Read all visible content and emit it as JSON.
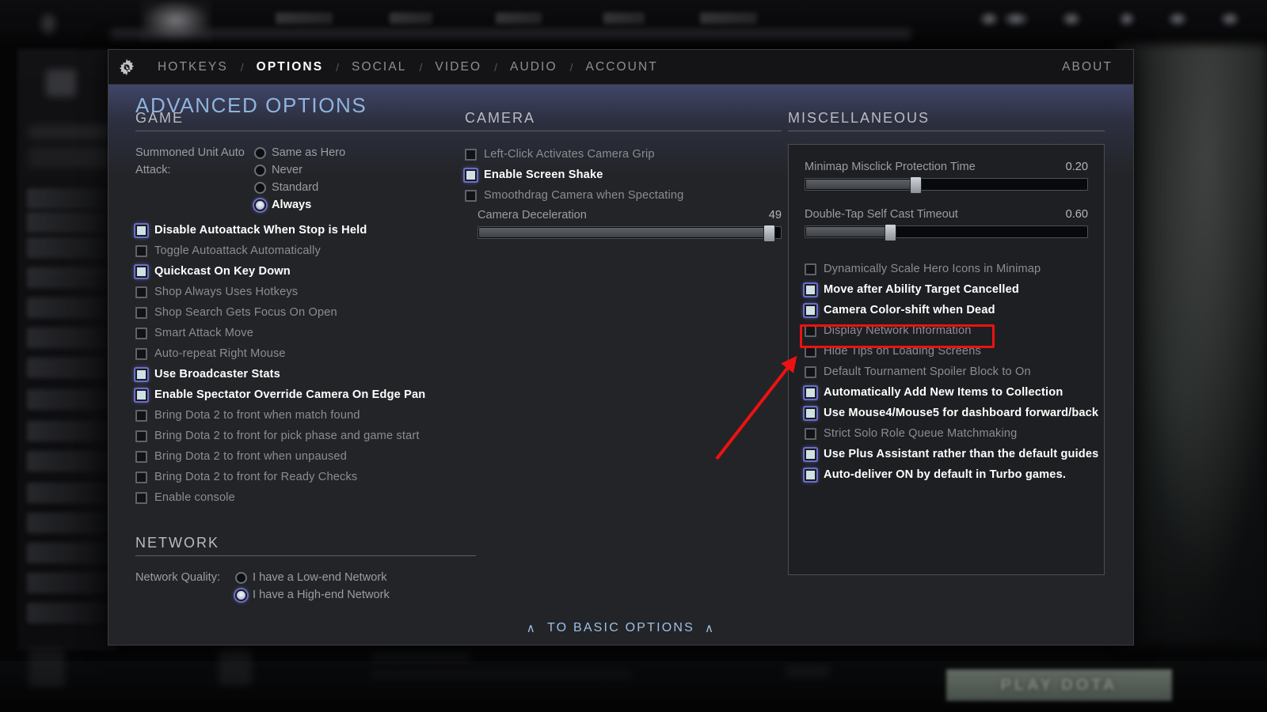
{
  "background": {
    "nav_items": [
      "HEROES",
      "STORE",
      "WATCH",
      "LEARN",
      "ARCADE"
    ],
    "play_button_label": "PLAY DOTA"
  },
  "header": {
    "gear_icon": "gear-cursor-icon",
    "tabs": [
      {
        "label": "HOTKEYS",
        "active": false
      },
      {
        "label": "OPTIONS",
        "active": true
      },
      {
        "label": "SOCIAL",
        "active": false
      },
      {
        "label": "VIDEO",
        "active": false
      },
      {
        "label": "AUDIO",
        "active": false
      },
      {
        "label": "ACCOUNT",
        "active": false
      }
    ],
    "separator": "/",
    "about_label": "ABOUT"
  },
  "page_title": "ADVANCED OPTIONS",
  "game": {
    "heading": "GAME",
    "summoned_unit": {
      "label": "Summoned Unit Auto Attack:",
      "options": [
        {
          "label": "Same as Hero",
          "selected": false
        },
        {
          "label": "Never",
          "selected": false
        },
        {
          "label": "Standard",
          "selected": false
        },
        {
          "label": "Always",
          "selected": true
        }
      ]
    },
    "checkboxes": [
      {
        "label": "Disable Autoattack When Stop is Held",
        "checked": true
      },
      {
        "label": "Toggle Autoattack Automatically",
        "checked": false
      },
      {
        "label": "Quickcast On Key Down",
        "checked": true
      },
      {
        "label": "Shop Always Uses Hotkeys",
        "checked": false
      },
      {
        "label": "Shop Search Gets Focus On Open",
        "checked": false
      },
      {
        "label": "Smart Attack Move",
        "checked": false
      },
      {
        "label": "Auto-repeat Right Mouse",
        "checked": false
      },
      {
        "label": "Use Broadcaster Stats",
        "checked": true
      },
      {
        "label": "Enable Spectator Override Camera On Edge Pan",
        "checked": true
      },
      {
        "label": "Bring Dota 2 to front when match found",
        "checked": false
      },
      {
        "label": "Bring Dota 2 to front for pick phase and game start",
        "checked": false
      },
      {
        "label": "Bring Dota 2 to front when unpaused",
        "checked": false
      },
      {
        "label": "Bring Dota 2 to front for Ready Checks",
        "checked": false
      },
      {
        "label": "Enable console",
        "checked": false
      }
    ]
  },
  "network": {
    "heading": "NETWORK",
    "quality_label": "Network Quality:",
    "options": [
      {
        "label": "I have a Low-end Network",
        "selected": false
      },
      {
        "label": "I have a High-end Network",
        "selected": true
      }
    ]
  },
  "camera": {
    "heading": "CAMERA",
    "checkboxes": [
      {
        "label": "Left-Click Activates Camera Grip",
        "checked": false
      },
      {
        "label": "Enable Screen Shake",
        "checked": true
      },
      {
        "label": "Smoothdrag Camera when Spectating",
        "checked": false
      }
    ],
    "slider": {
      "label": "Camera Deceleration",
      "value": "49",
      "percent": 96
    }
  },
  "miscellaneous": {
    "heading": "MISCELLANEOUS",
    "sliders": [
      {
        "label": "Minimap Misclick Protection Time",
        "value": "0.20",
        "percent": 39
      },
      {
        "label": "Double-Tap Self Cast Timeout",
        "value": "0.60",
        "percent": 30
      }
    ],
    "checkboxes": [
      {
        "label": "Dynamically Scale Hero Icons in Minimap",
        "checked": false
      },
      {
        "label": "Move after Ability Target Cancelled",
        "checked": true
      },
      {
        "label": "Camera Color-shift when Dead",
        "checked": true
      },
      {
        "label": "Display Network Information",
        "checked": false,
        "highlighted": true
      },
      {
        "label": "Hide Tips on Loading Screens",
        "checked": false
      },
      {
        "label": "Default Tournament Spoiler Block to On",
        "checked": false
      },
      {
        "label": "Automatically Add New Items to Collection",
        "checked": true
      },
      {
        "label": "Use Mouse4/Mouse5 for dashboard forward/back",
        "checked": true
      },
      {
        "label": "Strict Solo Role Queue Matchmaking",
        "checked": false
      },
      {
        "label": "Use Plus Assistant rather than the default guides",
        "checked": true
      },
      {
        "label": "Auto-deliver ON by default in Turbo games.",
        "checked": true
      }
    ]
  },
  "footer": {
    "basic_options_label": "TO BASIC OPTIONS",
    "chevron": "∧"
  },
  "annotations": {
    "highlight_color": "#ee1111",
    "arrow_color": "#ee1111",
    "target": "Display Network Information"
  }
}
